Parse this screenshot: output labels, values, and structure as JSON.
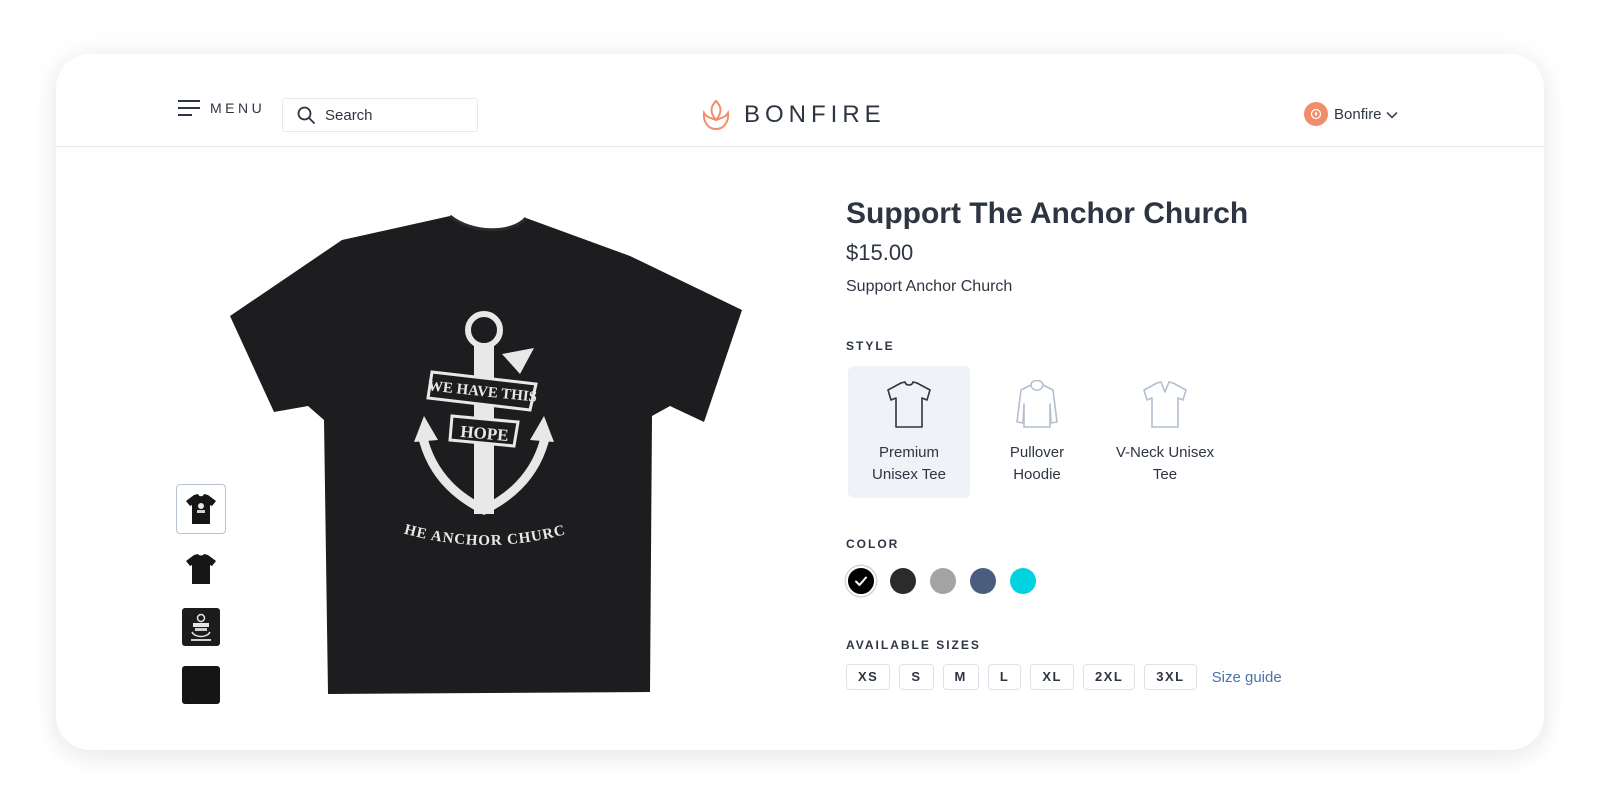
{
  "header": {
    "menu_label": "MENU",
    "search_placeholder": "Search",
    "brand_name": "BONFIRE",
    "account_name": "Bonfire"
  },
  "gallery": {
    "main_design_text": [
      "WE HAVE THIS",
      "HOPE",
      "- THE ANCHOR CHURCH -"
    ],
    "thumbnails": [
      {
        "name": "front-with-design",
        "selected": true
      },
      {
        "name": "back-plain",
        "selected": false
      },
      {
        "name": "design-closeup",
        "selected": false
      },
      {
        "name": "fabric-swatch",
        "selected": false
      }
    ]
  },
  "product": {
    "title": "Support The Anchor Church",
    "price": "$15.00",
    "description": "Support Anchor Church"
  },
  "style": {
    "label": "STYLE",
    "options": [
      {
        "line1": "Premium",
        "line2": "Unisex Tee",
        "icon": "tshirt-icon",
        "selected": true
      },
      {
        "line1": "Pullover",
        "line2": "Hoodie",
        "icon": "hoodie-icon",
        "selected": false
      },
      {
        "line1": "V-Neck Unisex",
        "line2": "Tee",
        "icon": "vneck-icon",
        "selected": false
      }
    ]
  },
  "color": {
    "label": "COLOR",
    "swatches": [
      "#000000",
      "#2b2b2b",
      "#a3a3a6",
      "#4a5d7e",
      "#00d2e0"
    ],
    "selected_index": 0
  },
  "sizes": {
    "label": "AVAILABLE SIZES",
    "options": [
      "XS",
      "S",
      "M",
      "L",
      "XL",
      "2XL",
      "3XL"
    ],
    "guide_label": "Size guide"
  },
  "colors": {
    "brand_accent": "#f28d6c",
    "text": "#2e3542",
    "link": "#4a73a8",
    "selected_style_bg": "#eff2f6"
  }
}
